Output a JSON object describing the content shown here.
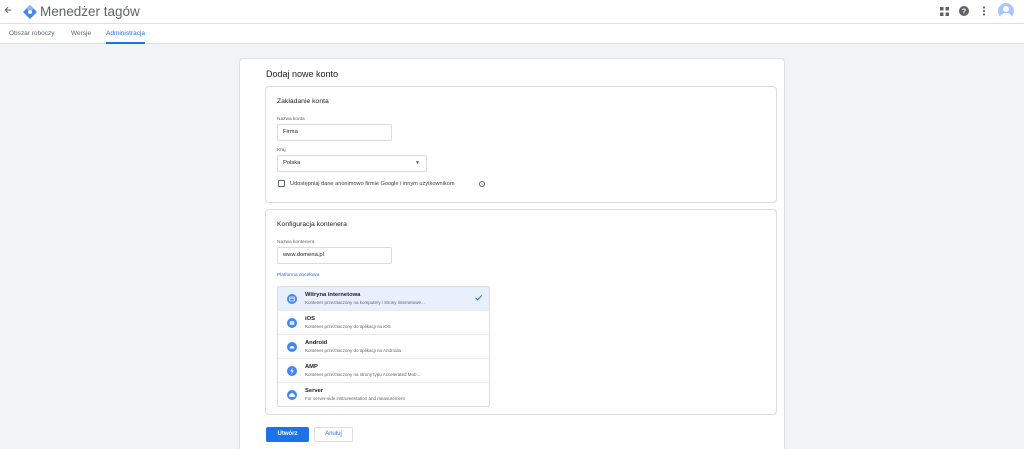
{
  "header": {
    "title": "Menedżer tagów",
    "brand_color": "#1a73e8",
    "icons": [
      "arrow-back-icon",
      "gtm-logo-icon",
      "apps-icon",
      "help-icon",
      "more-vert-icon",
      "avatar"
    ]
  },
  "tabs": [
    {
      "label": "Obszar roboczy",
      "active": false
    },
    {
      "label": "Wersje",
      "active": false
    },
    {
      "label": "Administracja",
      "active": true
    }
  ],
  "form": {
    "title": "Dodaj nowe konto",
    "account": {
      "title": "Zakładanie konta",
      "name_label": "Nazwa konta",
      "name_value": "Firma",
      "country_label": "Kraj",
      "country_value": "Polska",
      "share_label": "Udostępniaj dane anonimowo firmie Google i innym użytkownikom",
      "share_checked": false
    },
    "container": {
      "title": "Konfiguracja kontenera",
      "name_label": "Nazwa kontenera",
      "name_value": "www.domena.pl",
      "platform_label": "Platforma docelowa",
      "platforms": [
        {
          "name": "Witryna internetowa",
          "desc": "Kontener przeznaczony na komputery i strony internetowe...",
          "icon": "web-icon",
          "selected": true
        },
        {
          "name": "iOS",
          "desc": "Kontener przeznaczony do aplikacji na iOS",
          "icon": "ios-icon",
          "selected": false
        },
        {
          "name": "Android",
          "desc": "Kontener przeznaczony do aplikacji na Androida",
          "icon": "android-icon",
          "selected": false
        },
        {
          "name": "AMP",
          "desc": "Kontener przeznaczony na strony typu Accelerated Mob...",
          "icon": "amp-icon",
          "selected": false
        },
        {
          "name": "Server",
          "desc": "For server-side instrumentation and measurement",
          "icon": "cloud-icon",
          "selected": false
        }
      ]
    },
    "create_label": "Utwórz",
    "cancel_label": "Anuluj"
  }
}
